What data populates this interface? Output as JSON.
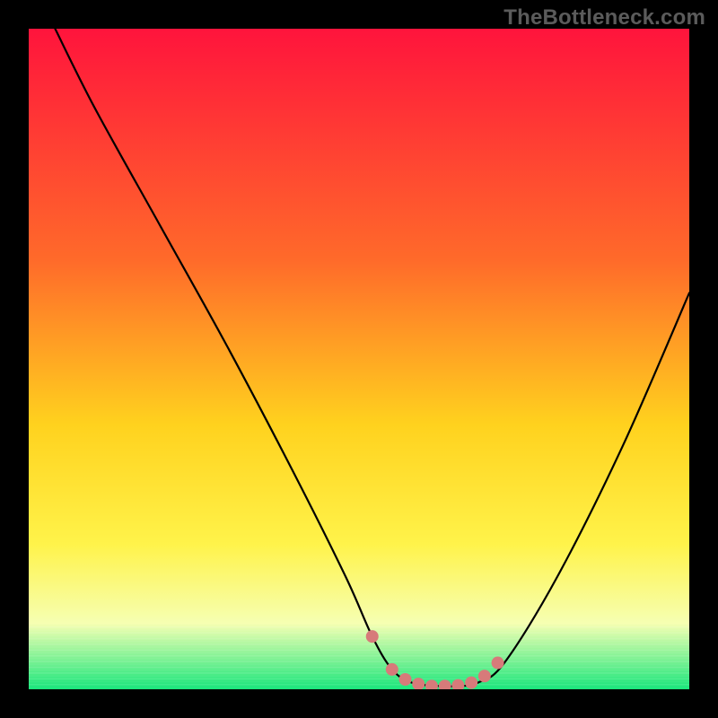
{
  "watermark": "TheBottleneck.com",
  "colors": {
    "frame": "#000000",
    "grad_top": "#ff143c",
    "grad_mid1": "#ff6a2a",
    "grad_mid2": "#ffd21e",
    "grad_mid3": "#fff34a",
    "grad_low": "#f6ffb2",
    "grad_bottom": "#17e67a",
    "curve": "#000000",
    "marker_fill": "#d77a7a",
    "marker_stroke": "#d77a7a"
  },
  "chart_data": {
    "type": "line",
    "title": "",
    "xlabel": "",
    "ylabel": "",
    "xlim": [
      0,
      100
    ],
    "ylim": [
      0,
      100
    ],
    "series": [
      {
        "name": "bottleneck-curve",
        "x": [
          4,
          10,
          20,
          30,
          40,
          48,
          52,
          55,
          58,
          62,
          65,
          68,
          72,
          80,
          90,
          100
        ],
        "y": [
          100,
          88,
          70,
          52,
          33,
          17,
          8,
          3,
          1,
          0.5,
          0.5,
          1,
          4,
          17,
          37,
          60
        ]
      }
    ],
    "markers": {
      "name": "highlight-dots",
      "x": [
        52,
        55,
        57,
        59,
        61,
        63,
        65,
        67,
        69,
        71
      ],
      "y": [
        8,
        3,
        1.5,
        0.8,
        0.5,
        0.5,
        0.6,
        1.0,
        2,
        4
      ]
    }
  }
}
